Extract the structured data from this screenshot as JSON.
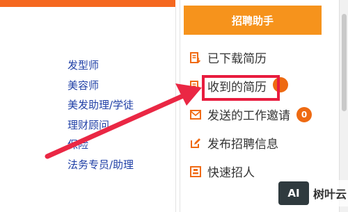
{
  "left": {
    "jobs": [
      "发型师",
      "美容师",
      "美发助理/学徒",
      "理财顾问",
      "保险",
      "法务专员/助理"
    ]
  },
  "right": {
    "header_title": "招聘助手",
    "items": [
      {
        "label": "已下载简历",
        "icon": "resume-download-icon"
      },
      {
        "label": "收到的简历",
        "icon": "resume-received-icon"
      },
      {
        "label": "发送的工作邀请",
        "icon": "mail-icon"
      },
      {
        "label": "发布招聘信息",
        "icon": "edit-icon"
      },
      {
        "label": "快速招人",
        "icon": "quick-hire-icon"
      }
    ],
    "badges": {
      "received": "",
      "invitations": "0"
    }
  },
  "watermark": {
    "logo": "AI",
    "text": "树叶云"
  },
  "colors": {
    "header_orange": "#f6931c",
    "top_bar": "#f5681f",
    "link_blue": "#1f3fa6",
    "highlight_red": "#e81c3e",
    "badge_orange": "#ee6a12"
  }
}
